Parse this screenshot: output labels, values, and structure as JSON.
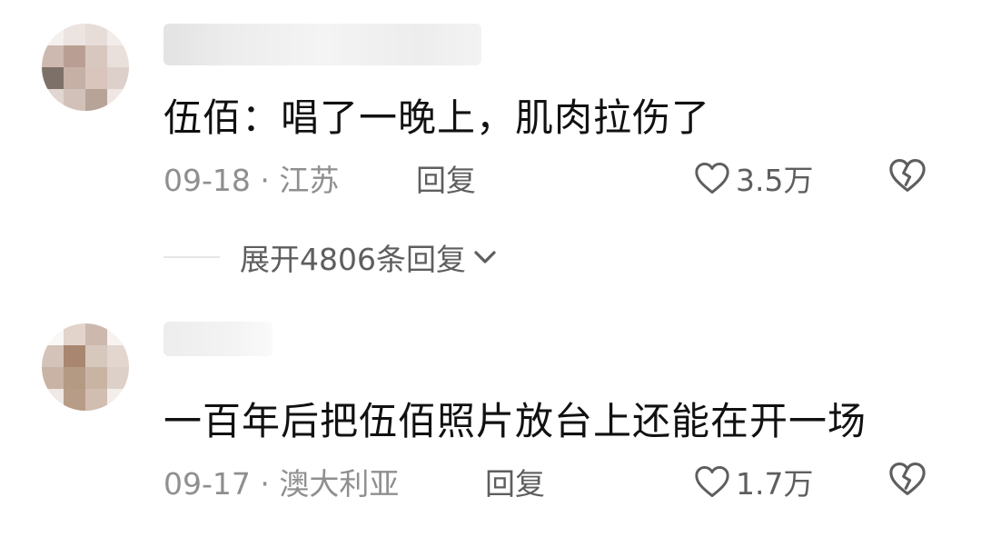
{
  "comments": [
    {
      "text": "伍佰：唱了一晚上，肌肉拉伤了",
      "date_location": "09-18 · 江苏",
      "reply_label": "回复",
      "like_count": "3.5万"
    },
    {
      "text": "一百年后把伍佰照片放台上还能在开一场",
      "date_location": "09-17 · 澳大利亚",
      "reply_label": "回复",
      "like_count": "1.7万"
    }
  ],
  "expand_replies": {
    "label": "展开4806条回复"
  },
  "icons": {
    "like": "heart-outline-icon",
    "dislike": "broken-heart-icon",
    "expand": "chevron-down-icon"
  },
  "colors": {
    "text_primary": "#111111",
    "text_secondary": "#8f8f8f",
    "action": "#5e5e5e"
  }
}
